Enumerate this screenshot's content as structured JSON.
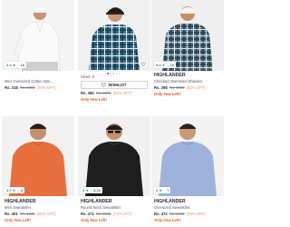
{
  "products": [
    {
      "rating": "4.4",
      "rating_count": "16",
      "brand": "",
      "title": "Men Oversized Cotton Stre...",
      "price": "Rs. 318",
      "mrp": "Rs. 2099",
      "discount": "(85% OFF)",
      "stock": ""
    },
    {
      "rating": "",
      "rating_count": "",
      "brand": "",
      "title": "",
      "sizes": "Sizes: S",
      "wishlist_label": "WISHLIST",
      "price": "Rs. 380",
      "mrp": "Rs. 2299",
      "discount": "(83% OFF)",
      "stock": "Only Few Left!"
    },
    {
      "rating": "4.4",
      "rating_count": "16",
      "brand": "HIGHLANDER",
      "title": "Checked Oversized Shacket",
      "price": "Rs. 398",
      "mrp": "Rs. 2399",
      "discount": "(83% OFF)",
      "stock": "Only Few Left!"
    },
    {
      "rating": "3.9",
      "rating_count": "6",
      "brand": "HIGHLANDER",
      "title": "Men Sweatshirt",
      "price": "Rs. 401",
      "mrp": "Rs. 1999",
      "discount": "(80% OFF)",
      "stock": "Only Few Left!"
    },
    {
      "rating": "4",
      "rating_count": "5.2k",
      "brand": "HIGHLANDER",
      "title": "Round Neck Sweatshirt",
      "price": "Rs. 472",
      "mrp": "Rs. 2249",
      "discount": "(79% OFF)",
      "stock": "Only Few Left!"
    },
    {
      "rating": "4",
      "rating_count": "7",
      "brand": "HIGHLANDER",
      "title": "Oversized Sweatshirt",
      "price": "Rs. 472",
      "mrp": "Rs. 2249",
      "discount": "(79% OFF)",
      "stock": "Only Few Left!"
    }
  ],
  "colors": {
    "accent": "#ff3f6c",
    "discount": "#ff905a",
    "few_left": "#ff5722",
    "star": "#14958f"
  },
  "icons": [
    "star-icon",
    "heart-icon"
  ]
}
